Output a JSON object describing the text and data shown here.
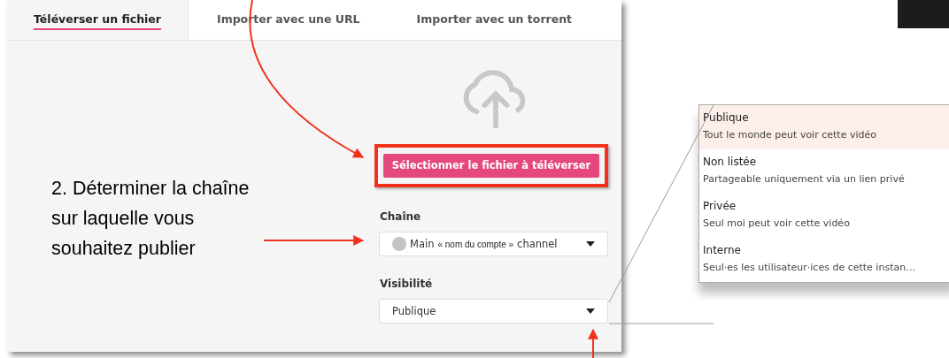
{
  "tabs": [
    {
      "label": "Téléverser un fichier",
      "selected": true
    },
    {
      "label": "Importer avec une URL",
      "selected": false
    },
    {
      "label": "Importer avec un torrent",
      "selected": false
    }
  ],
  "annotation": "2. Déterminer la chaîne sur laquelle vous souhaitez publier",
  "upload_button": "Sélectionner le fichier à téléverser",
  "channel": {
    "label": "Chaîne",
    "name": "Main",
    "account": "« nom du compte »",
    "suffix": "channel"
  },
  "visibility": {
    "label": "Visibilité",
    "value": "Publique"
  },
  "visibility_options": [
    {
      "title": "Publique",
      "description": "Tout le monde peut voir cette vidéo",
      "selected": true
    },
    {
      "title": "Non listée",
      "description": "Partageable uniquement via un lien privé",
      "selected": false
    },
    {
      "title": "Privée",
      "description": "Seul moi peut voir cette vidéo",
      "selected": false
    },
    {
      "title": "Interne",
      "description": "Seul·es les utilisateur·ices de cette instan…",
      "selected": false
    }
  ]
}
